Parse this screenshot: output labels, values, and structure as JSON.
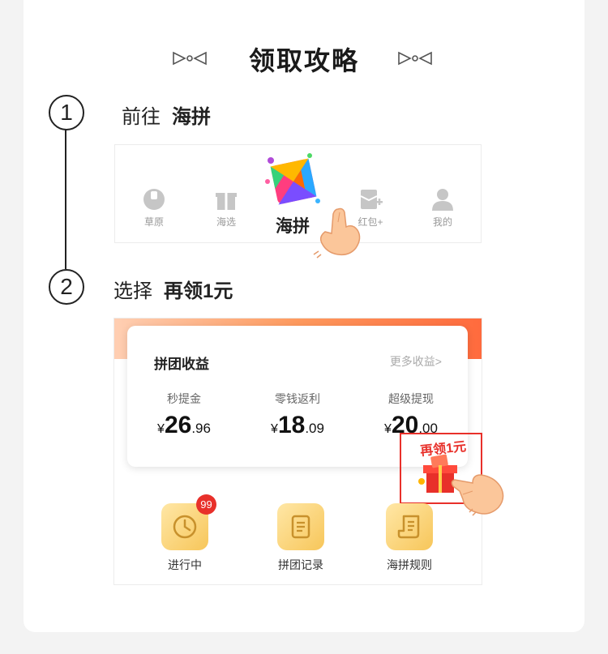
{
  "title": "领取攻略",
  "steps": [
    {
      "number": "1",
      "action": "前往",
      "target": "海拼"
    },
    {
      "number": "2",
      "action": "选择",
      "target": "再领1元"
    }
  ],
  "tabbar": {
    "tabs": [
      {
        "label": "草原",
        "icon": "grassland-icon"
      },
      {
        "label": "海选",
        "icon": "gift-icon"
      },
      {
        "label": "海拼",
        "icon": "haipin-logo-icon"
      },
      {
        "label": "红包+",
        "icon": "red-packet-plus-icon"
      },
      {
        "label": "我的",
        "icon": "profile-icon"
      }
    ]
  },
  "income": {
    "title": "拼团收益",
    "more": "更多收益>",
    "currency": "¥",
    "columns": [
      {
        "label": "秒提金",
        "int": "26",
        "dec": ".96"
      },
      {
        "label": "零钱返利",
        "int": "18",
        "dec": ".09"
      },
      {
        "label": "超级提现",
        "int": "20",
        "dec": ".00"
      }
    ]
  },
  "promo": {
    "text": "再领1元"
  },
  "actions": [
    {
      "label": "进行中",
      "icon": "clock-icon",
      "badge": "99"
    },
    {
      "label": "拼团记录",
      "icon": "record-icon"
    },
    {
      "label": "海拼规则",
      "icon": "rules-icon"
    }
  ],
  "colors": {
    "accent": "#ff6a3d",
    "highlight": "#e8302a",
    "icon_bg": "#f7c65a"
  }
}
